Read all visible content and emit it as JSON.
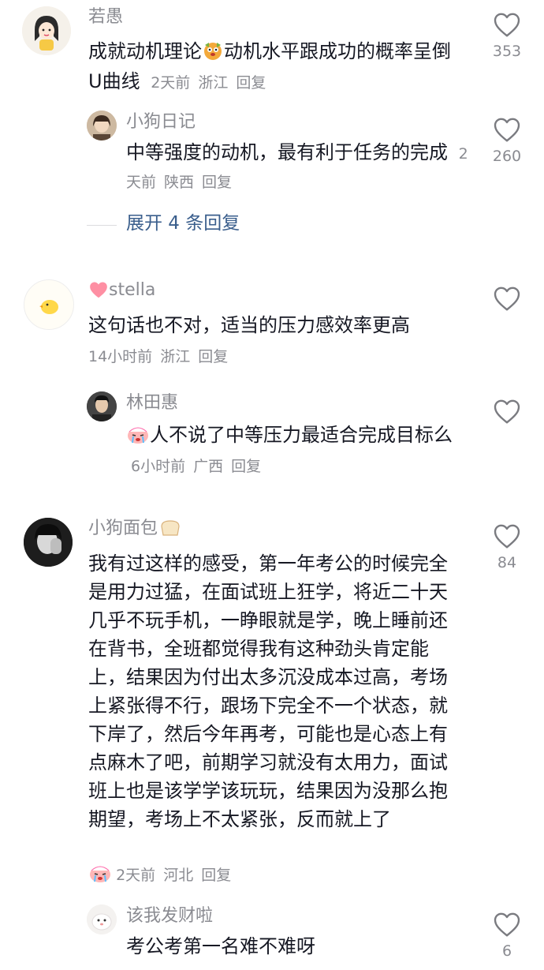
{
  "comments": [
    {
      "user": "若愚",
      "text_a": "成就动机理论",
      "text_b": "动机水平跟成功的概率呈倒U曲线",
      "time": "2天前",
      "location": "浙江",
      "reply": "回复",
      "likes": "353",
      "avatar_icon": "girl-cartoon-avatar",
      "replies": [
        {
          "user": "小狗日记",
          "text": "中等强度的动机，最有利于任务的完成",
          "time": "2天前",
          "location": "陕西",
          "reply": "回复",
          "likes": "260"
        }
      ],
      "expand_label": "展开 4 条回复"
    },
    {
      "user": "stella",
      "text": "这句话也不对，适当的压力感效率更高",
      "time": "14小时前",
      "location": "浙江",
      "reply": "回复",
      "likes": "",
      "replies": [
        {
          "user": "林田惠",
          "text": "人不说了中等压力最适合完成目标么",
          "time": "6小时前",
          "location": "广西",
          "reply": "回复",
          "likes": ""
        }
      ]
    },
    {
      "user": "小狗面包",
      "text": "我有过这样的感受，第一年考公的时候完全是用力过猛，在面试班上狂学，将近二十天几乎不玩手机，一睁眼就是学，晚上睡前还在背书，全班都觉得我有这种劲头肯定能上，结果因为付出太多沉没成本过高，考场上紧张得不行，跟场下完全不一个状态，就下岸了，然后今年再考，可能也是心态上有点麻木了吧，前期学习就没有太用力，面试班上也是该学学该玩玩，结果因为没那么抱期望，考场上不太紧张，反而就上了",
      "time": "2天前",
      "location": "河北",
      "reply": "回复",
      "likes": "84",
      "replies": [
        {
          "user": "该我发财啦",
          "text": "考公考第一名难不难呀",
          "time": "",
          "location": "",
          "reply": "",
          "likes": "6"
        }
      ]
    }
  ],
  "colors": {
    "text": "#161823",
    "meta": "#8a8b91",
    "expand": "#3a5e8c",
    "heart": "#fe6f87"
  }
}
